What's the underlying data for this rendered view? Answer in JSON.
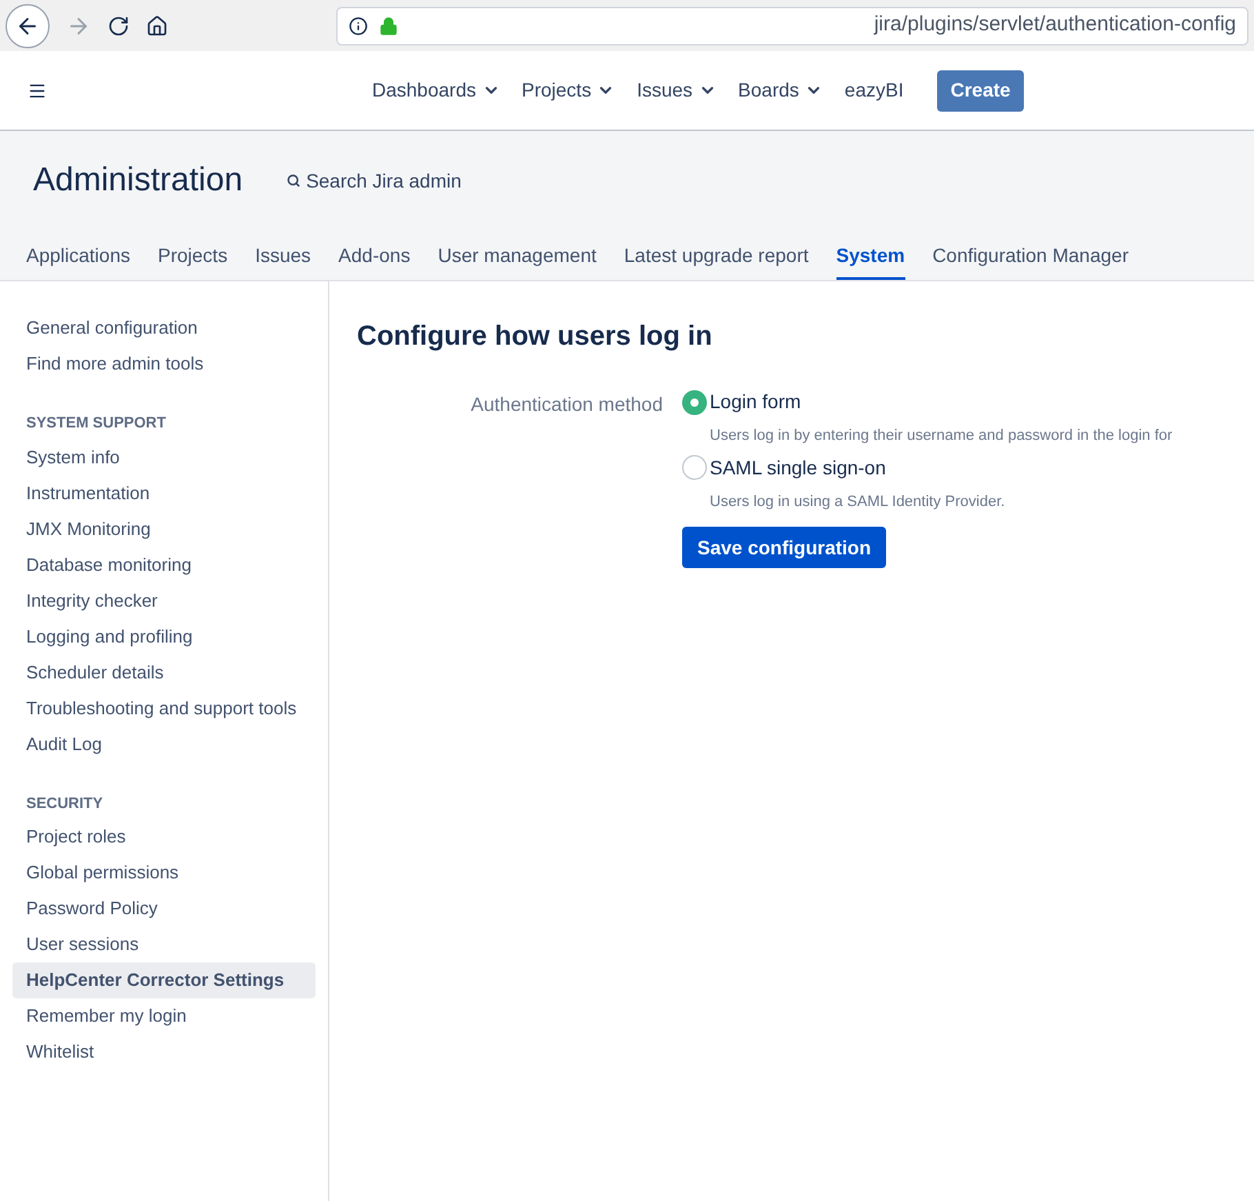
{
  "browser": {
    "url": "jira/plugins/servlet/authentication-config"
  },
  "top_nav": {
    "items": [
      {
        "label": "Dashboards",
        "dropdown": true
      },
      {
        "label": "Projects",
        "dropdown": true
      },
      {
        "label": "Issues",
        "dropdown": true
      },
      {
        "label": "Boards",
        "dropdown": true
      },
      {
        "label": "eazyBI",
        "dropdown": false
      }
    ],
    "create": "Create"
  },
  "admin": {
    "title": "Administration",
    "search": "Search Jira admin"
  },
  "tabs": [
    {
      "label": "Applications",
      "selected": false
    },
    {
      "label": "Projects",
      "selected": false
    },
    {
      "label": "Issues",
      "selected": false
    },
    {
      "label": "Add-ons",
      "selected": false
    },
    {
      "label": "User management",
      "selected": false
    },
    {
      "label": "Latest upgrade report",
      "selected": false
    },
    {
      "label": "System",
      "selected": true
    },
    {
      "label": "Configuration Manager",
      "selected": false
    }
  ],
  "sidebar": [
    {
      "kind": "item",
      "label": "General configuration",
      "selected": false
    },
    {
      "kind": "item",
      "label": "Find more admin tools",
      "selected": false
    },
    {
      "kind": "heading",
      "label": "SYSTEM SUPPORT"
    },
    {
      "kind": "item",
      "label": "System info",
      "selected": false
    },
    {
      "kind": "item",
      "label": "Instrumentation",
      "selected": false
    },
    {
      "kind": "item",
      "label": "JMX Monitoring",
      "selected": false
    },
    {
      "kind": "item",
      "label": "Database monitoring",
      "selected": false
    },
    {
      "kind": "item",
      "label": "Integrity checker",
      "selected": false
    },
    {
      "kind": "item",
      "label": "Logging and profiling",
      "selected": false
    },
    {
      "kind": "item",
      "label": "Scheduler details",
      "selected": false
    },
    {
      "kind": "item",
      "label": "Troubleshooting and support tools",
      "selected": false
    },
    {
      "kind": "item",
      "label": "Audit Log",
      "selected": false
    },
    {
      "kind": "heading",
      "label": "SECURITY"
    },
    {
      "kind": "item",
      "label": "Project roles",
      "selected": false
    },
    {
      "kind": "item",
      "label": "Global permissions",
      "selected": false
    },
    {
      "kind": "item",
      "label": "Password Policy",
      "selected": false
    },
    {
      "kind": "item",
      "label": "User sessions",
      "selected": false
    },
    {
      "kind": "item",
      "label": "HelpCenter Corrector Settings",
      "selected": true
    },
    {
      "kind": "item",
      "label": "Remember my login",
      "selected": false
    },
    {
      "kind": "item",
      "label": "Whitelist",
      "selected": false
    }
  ],
  "content": {
    "title": "Configure how users log in",
    "field_label": "Authentication method",
    "options": [
      {
        "label": "Login form",
        "description": "Users log in by entering their username and password in the login for",
        "selected": true
      },
      {
        "label": "SAML single sign-on",
        "description": "Users log in using a SAML Identity Provider.",
        "selected": false
      }
    ],
    "save": "Save configuration"
  }
}
